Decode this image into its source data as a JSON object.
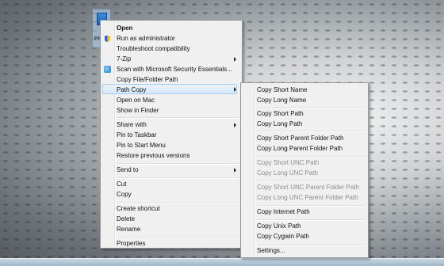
{
  "desktop": {
    "icon_label": "Plu"
  },
  "context_menu": {
    "items": [
      {
        "label": "Open"
      },
      {
        "label": "Run as administrator"
      },
      {
        "label": "Troubleshoot compatibility"
      },
      {
        "label": "7-Zip"
      },
      {
        "label": "Scan with Microsoft Security Essentials..."
      },
      {
        "label": "Copy File/Folder Path"
      },
      {
        "label": "Path Copy"
      },
      {
        "label": "Open on Mac"
      },
      {
        "label": "Show in Finder"
      },
      {
        "label": "Share with"
      },
      {
        "label": "Pin to Taskbar"
      },
      {
        "label": "Pin to Start Menu"
      },
      {
        "label": "Restore previous versions"
      },
      {
        "label": "Send to"
      },
      {
        "label": "Cut"
      },
      {
        "label": "Copy"
      },
      {
        "label": "Create shortcut"
      },
      {
        "label": "Delete"
      },
      {
        "label": "Rename"
      },
      {
        "label": "Properties"
      }
    ]
  },
  "path_copy_submenu": {
    "items": [
      {
        "label": "Copy Short Name"
      },
      {
        "label": "Copy Long Name"
      },
      {
        "label": "Copy Short Path"
      },
      {
        "label": "Copy Long Path"
      },
      {
        "label": "Copy Short Parent Folder Path"
      },
      {
        "label": "Copy Long Parent Folder Path"
      },
      {
        "label": "Copy Short UNC Path"
      },
      {
        "label": "Copy Long UNC Path"
      },
      {
        "label": "Copy Short UNC Parent Folder Path"
      },
      {
        "label": "Copy Long UNC Parent Folder Path"
      },
      {
        "label": "Copy Internet Path"
      },
      {
        "label": "Copy Unix Path"
      },
      {
        "label": "Copy Cygwin Path"
      },
      {
        "label": "Settings..."
      }
    ]
  }
}
